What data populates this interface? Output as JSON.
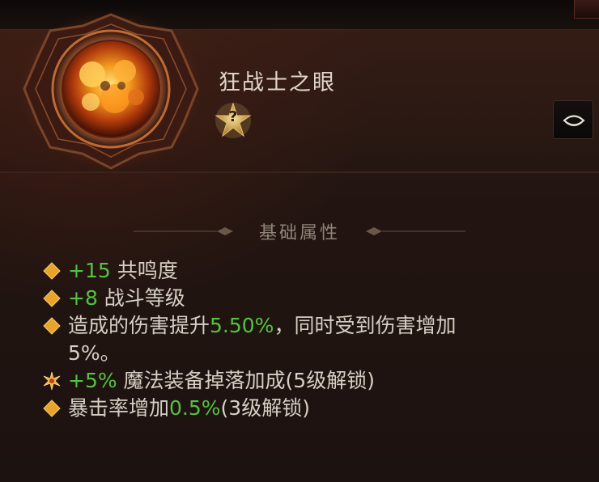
{
  "item": {
    "name": "狂战士之眼",
    "rank_badge": "?"
  },
  "section": {
    "title": "基础属性"
  },
  "stats": [
    {
      "value": "+15",
      "text": " 共鸣度"
    },
    {
      "value": "+8",
      "text": " 战斗等级"
    },
    {
      "prefix": "造成的伤害提升",
      "value": "5.50%",
      "text": "，同时受到伤害增加",
      "text2": "5%。"
    },
    {
      "value": "+5%",
      "text": " 魔法装备掉落加成(5级解锁)"
    },
    {
      "prefix": "暴击率增加",
      "value": "0.5%",
      "text": "(3级解锁)"
    }
  ],
  "icons": {
    "gem": "glowing-gem-icon",
    "rank": "star-badge-icon",
    "eye": "eye-icon",
    "bullet": "diamond-bullet-icon",
    "special_bullet": "starburst-bullet-icon"
  },
  "colors": {
    "bonus_value": "#55c243",
    "bullet": "#e8a42a",
    "title": "#e0d6c8"
  }
}
